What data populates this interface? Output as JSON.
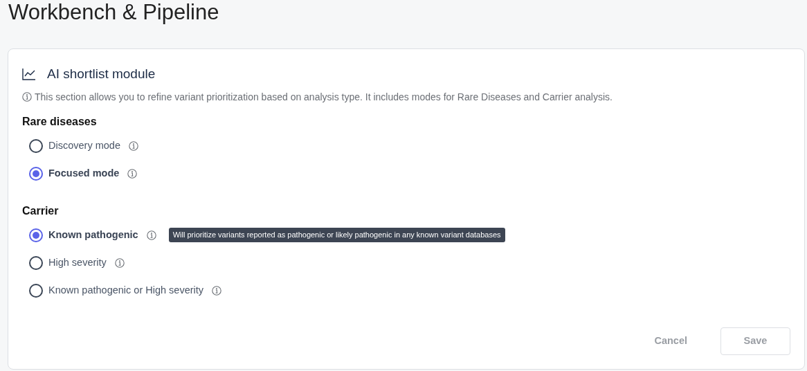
{
  "page_title": "Workbench & Pipeline",
  "module": {
    "title": "AI shortlist module",
    "description": "This section allows you to refine variant prioritization based on analysis type. It includes modes for Rare Diseases and Carrier analysis.",
    "groups": [
      {
        "heading": "Rare diseases",
        "options": [
          {
            "label": "Discovery mode",
            "selected": false
          },
          {
            "label": "Focused mode",
            "selected": true
          }
        ]
      },
      {
        "heading": "Carrier",
        "options": [
          {
            "label": "Known pathogenic",
            "selected": true,
            "tooltip": "Will prioritize variants reported as pathogenic or likely pathogenic in any known variant databases"
          },
          {
            "label": "High severity",
            "selected": false
          },
          {
            "label": "Known pathogenic or High severity",
            "selected": false
          }
        ]
      }
    ]
  },
  "actions": [
    {
      "label": "Cancel",
      "kind": "link",
      "disabled": true
    },
    {
      "label": "Save",
      "kind": "outline",
      "disabled": true
    }
  ]
}
